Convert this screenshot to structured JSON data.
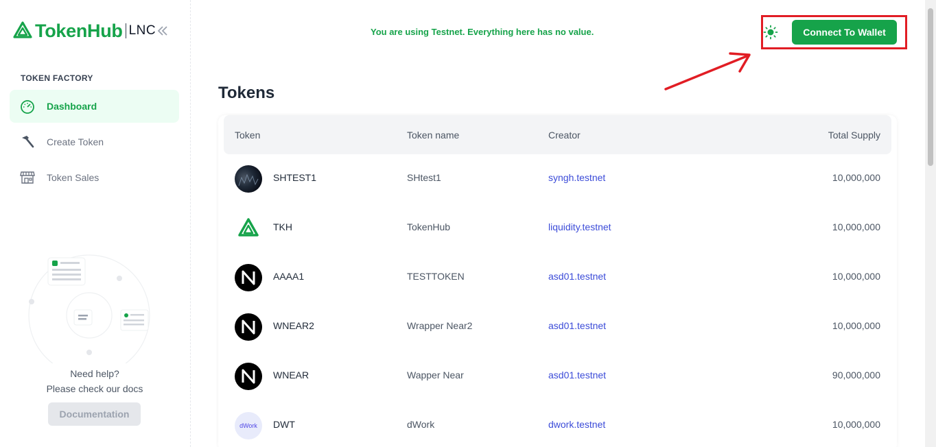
{
  "brand": {
    "name": "TokenHub",
    "suffix": "LNC",
    "accent": "#16a34a"
  },
  "sidebar": {
    "section_title": "TOKEN FACTORY",
    "items": [
      {
        "label": "Dashboard",
        "icon": "speedometer-icon",
        "active": true
      },
      {
        "label": "Create Token",
        "icon": "hammer-icon",
        "active": false
      },
      {
        "label": "Token Sales",
        "icon": "store-icon",
        "active": false
      }
    ],
    "help": {
      "line1": "Need help?",
      "line2": "Please check our docs",
      "button": "Documentation"
    }
  },
  "header": {
    "banner": "You are using Testnet. Everything here has no value.",
    "connect_label": "Connect To Wallet",
    "annotation_color": "#e11d24"
  },
  "main": {
    "title": "Tokens",
    "columns": [
      "Token",
      "Token name",
      "Creator",
      "Total Supply"
    ],
    "rows": [
      {
        "symbol": "SHTEST1",
        "name": "SHtest1",
        "creator": "syngh.testnet",
        "supply": "10,000,000",
        "icon": "dark-photo-icon"
      },
      {
        "symbol": "TKH",
        "name": "TokenHub",
        "creator": "liquidity.testnet",
        "supply": "10,000,000",
        "icon": "tokenhub-logo-icon"
      },
      {
        "symbol": "AAAA1",
        "name": "TESTTOKEN",
        "creator": "asd01.testnet",
        "supply": "10,000,000",
        "icon": "near-logo-icon"
      },
      {
        "symbol": "WNEAR2",
        "name": "Wrapper Near2",
        "creator": "asd01.testnet",
        "supply": "10,000,000",
        "icon": "near-logo-icon"
      },
      {
        "symbol": "WNEAR",
        "name": "Wapper Near",
        "creator": "asd01.testnet",
        "supply": "90,000,000",
        "icon": "near-logo-icon"
      },
      {
        "symbol": "DWT",
        "name": "dWork",
        "creator": "dwork.testnet",
        "supply": "10,000,000",
        "icon": "dwork-logo-icon",
        "icon_text": "dWork"
      }
    ]
  }
}
